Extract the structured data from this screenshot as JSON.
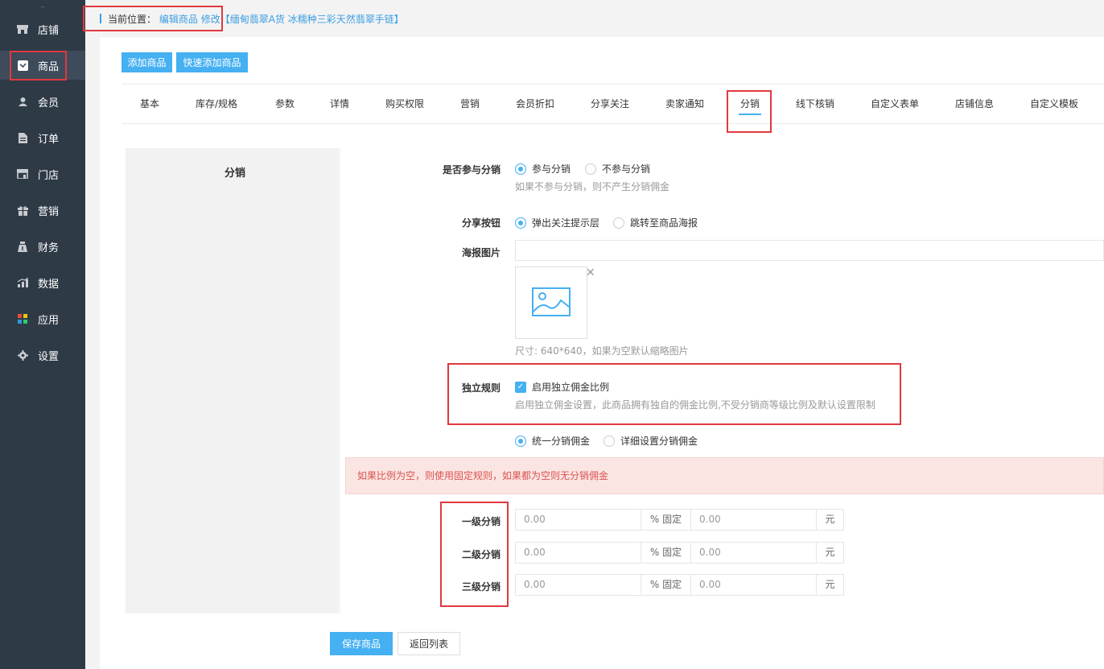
{
  "sidebar": {
    "top_glyph": "_",
    "items": [
      {
        "label": "店铺",
        "icon": "store-icon"
      },
      {
        "label": "商品",
        "icon": "goods-icon"
      },
      {
        "label": "会员",
        "icon": "member-icon"
      },
      {
        "label": "订单",
        "icon": "order-icon"
      },
      {
        "label": "门店",
        "icon": "shop-icon"
      },
      {
        "label": "营销",
        "icon": "gift-icon"
      },
      {
        "label": "财务",
        "icon": "finance-icon"
      },
      {
        "label": "数据",
        "icon": "chart-icon"
      },
      {
        "label": "应用",
        "icon": "apps-icon"
      },
      {
        "label": "设置",
        "icon": "gear-icon"
      }
    ],
    "active_index": 1
  },
  "breadcrumb": {
    "label": "当前位置：",
    "links": [
      "编辑商品",
      "修改"
    ],
    "goods_name": "【缅甸翡翠A货 冰糯种三彩天然翡翠手链】"
  },
  "toolbar": {
    "add_label": "添加商品",
    "quick_add_label": "快速添加商品"
  },
  "tabs": [
    "基本",
    "库存/规格",
    "参数",
    "详情",
    "购买权限",
    "营销",
    "会员折扣",
    "分享关注",
    "卖家通知",
    "分销",
    "线下核销",
    "自定义表单",
    "店铺信息",
    "自定义模板"
  ],
  "active_tab": "分销",
  "section_title": "分销",
  "form": {
    "join": {
      "label": "是否参与分销",
      "options": [
        "参与分销",
        "不参与分销"
      ],
      "selected": "参与分销",
      "help": "如果不参与分销，则不产生分销佣金"
    },
    "share_button": {
      "label": "分享按钮",
      "options": [
        "弹出关注提示层",
        "跳转至商品海报"
      ],
      "selected": "弹出关注提示层"
    },
    "poster": {
      "label": "海报图片",
      "input_value": "",
      "help": "尺寸: 640*640，如果为空默认缩略图片"
    },
    "independent": {
      "label": "独立规则",
      "checkbox_label": "启用独立佣金比例",
      "checked": true,
      "help": "启用独立佣金设置，此商品拥有独自的佣金比例,不受分销商等级比例及默认设置限制"
    },
    "commission_mode": {
      "options": [
        "统一分销佣金",
        "详细设置分销佣金"
      ],
      "selected": "统一分销佣金"
    },
    "alert": "如果比例为空，则使用固定规则，如果都为空则无分销佣金",
    "levels": [
      {
        "label": "一级分销",
        "percent_placeholder": "0.00",
        "percent_addon": "% 固定",
        "fixed_placeholder": "0.00",
        "unit": "元"
      },
      {
        "label": "二级分销",
        "percent_placeholder": "0.00",
        "percent_addon": "% 固定",
        "fixed_placeholder": "0.00",
        "unit": "元"
      },
      {
        "label": "三级分销",
        "percent_placeholder": "0.00",
        "percent_addon": "% 固定",
        "fixed_placeholder": "0.00",
        "unit": "元"
      }
    ]
  },
  "actions": {
    "save_label": "保存商品",
    "back_label": "返回列表"
  },
  "colors": {
    "accent": "#45b0f2",
    "sidebar_bg": "#2f3a47",
    "highlight": "#e0393e",
    "alert_bg": "#fbe5e3",
    "alert_text": "#d9534f"
  }
}
